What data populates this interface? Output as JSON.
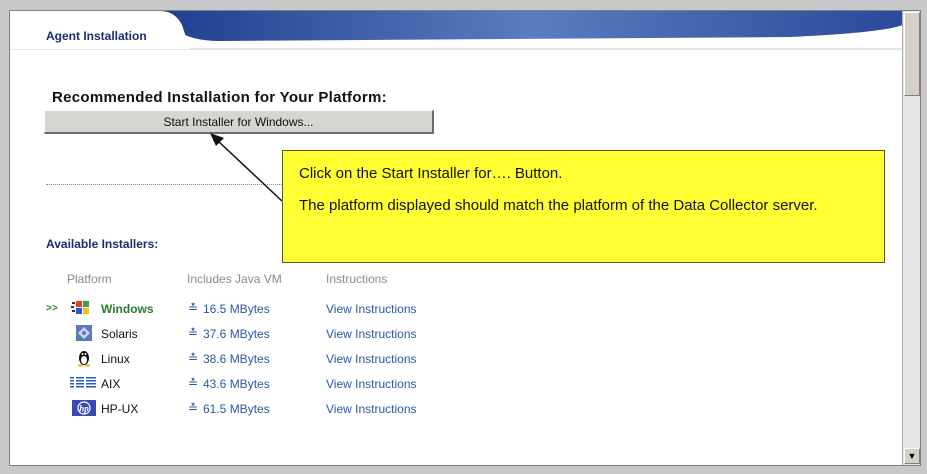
{
  "tab": {
    "label": "Agent Installation"
  },
  "recommended": {
    "heading": "Recommended Installation for Your Platform:",
    "button_label": "Start Installer for Windows..."
  },
  "callout": {
    "line1": "Click on the Start Installer for…. Button.",
    "line2": "The platform displayed should match the platform of the Data Collector server."
  },
  "available": {
    "heading": "Available Installers:",
    "columns": {
      "platform": "Platform",
      "java": "Includes Java VM",
      "instructions": "Instructions"
    },
    "selected_marker": ">>",
    "rows": [
      {
        "platform": "Windows",
        "size": "16.5 MBytes",
        "link": "View Instructions",
        "icon": "windows-icon",
        "selected": true
      },
      {
        "platform": "Solaris",
        "size": "37.6 MBytes",
        "link": "View Instructions",
        "icon": "solaris-icon",
        "selected": false
      },
      {
        "platform": "Linux",
        "size": "38.6 MBytes",
        "link": "View Instructions",
        "icon": "linux-icon",
        "selected": false
      },
      {
        "platform": "AIX",
        "size": "43.6 MBytes",
        "link": "View Instructions",
        "icon": "ibm-icon",
        "selected": false
      },
      {
        "platform": "HP-UX",
        "size": "61.5 MBytes",
        "link": "View Instructions",
        "icon": "hp-icon",
        "selected": false
      }
    ]
  },
  "colors": {
    "tab_blue": "#1a2e6e",
    "link_blue": "#2a58a8",
    "callout_yellow": "#ffff33",
    "selected_green": "#2a7a2a"
  }
}
